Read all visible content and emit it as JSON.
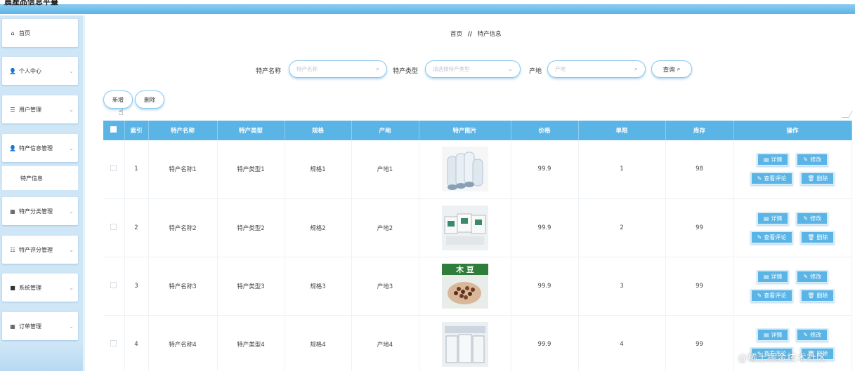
{
  "topbar": {
    "title": "農產品信息平臺"
  },
  "sidebar": {
    "items": [
      {
        "label": "首页",
        "icon": "home-icon",
        "glyph": "⌂"
      },
      {
        "label": "个人中心",
        "icon": "user-icon",
        "glyph": "👤"
      },
      {
        "label": "用户管理",
        "icon": "list-icon",
        "glyph": "☰"
      },
      {
        "label": "特产信息管理",
        "icon": "user-icon",
        "glyph": "👤"
      },
      {
        "label": "特产信息",
        "icon": "",
        "glyph": ""
      },
      {
        "label": "特产分类管理",
        "icon": "grid-icon",
        "glyph": "▦"
      },
      {
        "label": "特产评分管理",
        "icon": "sliders-icon",
        "glyph": "☷"
      },
      {
        "label": "系统管理",
        "icon": "box-icon",
        "glyph": "■"
      },
      {
        "label": "订单管理",
        "icon": "grid-icon",
        "glyph": "▦"
      }
    ]
  },
  "breadcrumb": {
    "home": "首页",
    "sep": "//",
    "current": "特产信息"
  },
  "search": {
    "name_label": "特产名称",
    "name_placeholder": "特产名称",
    "type_label": "特产类型",
    "type_placeholder": "请选择特产类型",
    "origin_label": "产地",
    "origin_placeholder": "产地",
    "query_label": "查询"
  },
  "actions": {
    "add_label": "新增",
    "delete_label": "删除"
  },
  "table": {
    "headers": [
      "索引",
      "特产名称",
      "特产类型",
      "规格",
      "产地",
      "特产图片",
      "价格",
      "单限",
      "库存",
      "操作"
    ],
    "ops": {
      "detail": "详情",
      "edit": "修改",
      "reviews": "查看评论",
      "delete": "删除"
    },
    "rows": [
      {
        "index": "1",
        "name": "特产名称1",
        "type": "特产类型1",
        "spec": "规格1",
        "origin": "产地1",
        "price": "99.9",
        "limit": "1",
        "stock": "98"
      },
      {
        "index": "2",
        "name": "特产名称2",
        "type": "特产类型2",
        "spec": "规格2",
        "origin": "产地2",
        "price": "99.9",
        "limit": "2",
        "stock": "99"
      },
      {
        "index": "3",
        "name": "特产名称3",
        "type": "特产类型3",
        "spec": "规格3",
        "origin": "产地3",
        "price": "99.9",
        "limit": "3",
        "stock": "99",
        "image_text": "木 豆"
      },
      {
        "index": "4",
        "name": "特产名称4",
        "type": "特产类型4",
        "spec": "规格4",
        "origin": "产地4",
        "price": "99.9",
        "limit": "4",
        "stock": "99"
      }
    ]
  },
  "watermark": "@稀土掘金技术社区",
  "colors": {
    "accent": "#5ab4e5",
    "sidebar_bg": "#cfe6f7",
    "header_bar": "#5cb3e6"
  }
}
